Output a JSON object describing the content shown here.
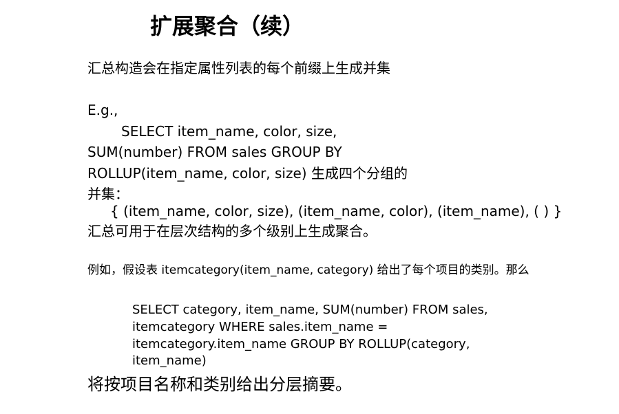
{
  "slide": {
    "title": "扩展聚合（续）",
    "intro": "汇总构造会在指定属性列表的每个前缀上生成并集",
    "example_label": "E.g.,",
    "example1_lines": [
      "SELECT item_name, color, size,",
      "SUM(number) FROM sales GROUP BY",
      "ROLLUP(item_name, color, size) 生成四个分组的",
      "并集：",
      "{ (item_name, color, size), (item_name, color), (item_name), ( ) }"
    ],
    "rollup_note": "汇总可用于在层次结构的多个级别上生成聚合。",
    "example2_intro": "例如，假设表 itemcategory(item_name, category) 给出了每个项目的类别。那么",
    "example2_query_lines": [
      "SELECT category, item_name, SUM(number) FROM sales,",
      "itemcategory WHERE sales.item_name =",
      "itemcategory.item_name GROUP BY ROLLUP(category,",
      "item_name)"
    ],
    "conclusion": "将按项目名称和类别给出分层摘要。"
  }
}
